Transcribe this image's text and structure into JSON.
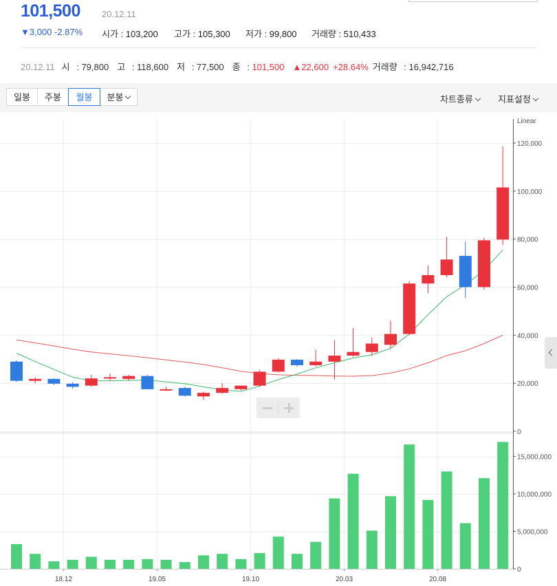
{
  "header": {
    "price": "101,500",
    "date": "20.12.11",
    "change": "▼3,000 -2.87%",
    "open_label": "시가",
    "open": "103,200",
    "high_label": "고가",
    "high": "105,300",
    "low_label": "저가",
    "low": "99,800",
    "vol_label": "거래량",
    "vol": "510,433"
  },
  "summary": {
    "date": "20.12.11",
    "o_label": "시",
    "o": "79,800",
    "h_label": "고",
    "h": "118,600",
    "l_label": "저",
    "l": "77,500",
    "c_label": "종",
    "c": "101,500",
    "chg": "▲22,600",
    "pct": "+28.64%",
    "v_label": "거래량",
    "v": "16,942,716"
  },
  "toolbar": {
    "tabs": [
      "일봉",
      "주봉",
      "월봉",
      "분봉"
    ],
    "active_tab": "월봉",
    "chart_type": "차트종류",
    "indicator": "지표설정"
  },
  "colors": {
    "up": "#e8323c",
    "down": "#2f7be0",
    "ma_short": "#3cb86a",
    "ma_long": "#e05a5a",
    "volume": "#4fce7c",
    "accent": "#2c5fd6"
  },
  "chart_data": [
    {
      "type": "candlestick",
      "scale_label": "Linear",
      "ylim": [
        0,
        130000
      ],
      "yticks": [
        0,
        20000,
        40000,
        60000,
        80000,
        100000,
        120000
      ],
      "ytick_labels": [
        "0",
        "20,000",
        "40,000",
        "60,000",
        "80,000",
        "100,000",
        "120,000"
      ],
      "xtick_labels": [
        "18.12",
        "19.05",
        "19.10",
        "20.03",
        "20.08"
      ],
      "xtick_index": [
        2,
        7,
        12,
        17,
        22
      ],
      "candles": [
        {
          "o": 29000,
          "h": 29500,
          "l": 20500,
          "c": 21000
        },
        {
          "o": 21000,
          "h": 22500,
          "l": 20000,
          "c": 21800
        },
        {
          "o": 21800,
          "h": 22000,
          "l": 19200,
          "c": 19800
        },
        {
          "o": 19800,
          "h": 20500,
          "l": 17800,
          "c": 18500
        },
        {
          "o": 19000,
          "h": 23500,
          "l": 18500,
          "c": 22000
        },
        {
          "o": 22000,
          "h": 24000,
          "l": 21000,
          "c": 22500
        },
        {
          "o": 21800,
          "h": 23500,
          "l": 21000,
          "c": 23000
        },
        {
          "o": 23000,
          "h": 23500,
          "l": 17500,
          "c": 17500
        },
        {
          "o": 17500,
          "h": 18500,
          "l": 16800,
          "c": 17500
        },
        {
          "o": 18000,
          "h": 18500,
          "l": 14500,
          "c": 14800
        },
        {
          "o": 14500,
          "h": 16500,
          "l": 13000,
          "c": 16000
        },
        {
          "o": 16000,
          "h": 20000,
          "l": 15500,
          "c": 18000
        },
        {
          "o": 17500,
          "h": 19000,
          "l": 17000,
          "c": 19000
        },
        {
          "o": 19000,
          "h": 25500,
          "l": 18500,
          "c": 24800
        },
        {
          "o": 24800,
          "h": 30500,
          "l": 24500,
          "c": 29800
        },
        {
          "o": 29800,
          "h": 30000,
          "l": 26800,
          "c": 27500
        },
        {
          "o": 27500,
          "h": 34000,
          "l": 27000,
          "c": 29000
        },
        {
          "o": 29000,
          "h": 38000,
          "l": 21500,
          "c": 31500
        },
        {
          "o": 31500,
          "h": 43000,
          "l": 31000,
          "c": 33000
        },
        {
          "o": 33000,
          "h": 39000,
          "l": 31500,
          "c": 36500
        },
        {
          "o": 36000,
          "h": 46000,
          "l": 34500,
          "c": 40500
        },
        {
          "o": 40500,
          "h": 62500,
          "l": 40000,
          "c": 61500
        },
        {
          "o": 61500,
          "h": 69000,
          "l": 57500,
          "c": 65000
        },
        {
          "o": 65000,
          "h": 81000,
          "l": 64000,
          "c": 71500
        },
        {
          "o": 73000,
          "h": 79000,
          "l": 55500,
          "c": 60000
        },
        {
          "o": 60000,
          "h": 80500,
          "l": 59000,
          "c": 79500
        },
        {
          "o": 79800,
          "h": 118600,
          "l": 77500,
          "c": 101500
        }
      ],
      "ma_short": [
        32500,
        29000,
        25800,
        22500,
        21000,
        21000,
        21200,
        21300,
        20600,
        19800,
        18500,
        17200,
        16600,
        18800,
        21500,
        23800,
        26400,
        28500,
        30500,
        31800,
        34500,
        40500,
        48500,
        56000,
        61000,
        67000,
        75500
      ],
      "ma_long": [
        38000,
        36800,
        35500,
        34200,
        33000,
        32200,
        31400,
        30600,
        29700,
        28800,
        27800,
        26400,
        25000,
        24000,
        23500,
        23300,
        23200,
        23000,
        22900,
        23200,
        24200,
        26000,
        28500,
        31500,
        33500,
        36500,
        40000
      ],
      "volumes": [
        3300000,
        2000000,
        1000000,
        1200000,
        1600000,
        1200000,
        1200000,
        1300000,
        1200000,
        900000,
        1800000,
        2000000,
        1300000,
        2100000,
        4300000,
        2000000,
        3600000,
        9400000,
        12700000,
        5100000,
        9700000,
        16600000,
        9200000,
        13000000,
        6100000,
        12100000,
        16942716
      ]
    },
    {
      "type": "bar",
      "ylim": [
        0,
        18000000
      ],
      "yticks": [
        0,
        5000000,
        10000000,
        15000000
      ],
      "ytick_labels": [
        "0",
        "5,000,000",
        "10,000,000",
        "15,000,000"
      ]
    }
  ]
}
